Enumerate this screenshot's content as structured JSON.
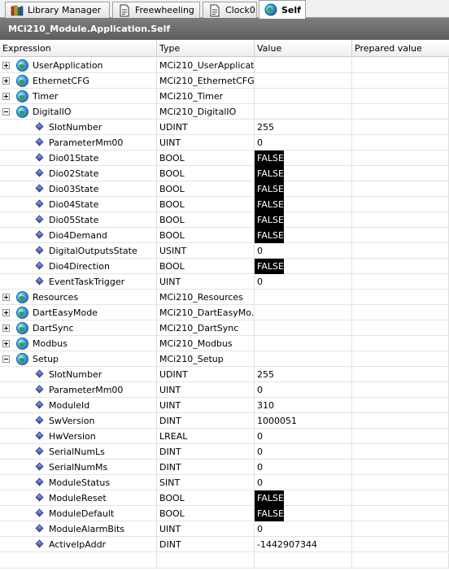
{
  "tabs": [
    {
      "label": "Library Manager",
      "icon": "library-icon",
      "active": false
    },
    {
      "label": "Freewheeling",
      "icon": "document-icon",
      "active": false
    },
    {
      "label": "Clock0",
      "icon": "document-icon",
      "active": false
    },
    {
      "label": "Self",
      "icon": "globe-icon",
      "active": true
    }
  ],
  "title": "MCi210_Module.Application.Self",
  "columns": {
    "expression": "Expression",
    "type": "Type",
    "value": "Value",
    "prepared": "Prepared value"
  },
  "rows": [
    {
      "level": 0,
      "expander": "plus",
      "icon": "globe-icon",
      "name": "UserApplication",
      "type": "MCi210_UserApplicat...",
      "value": "",
      "value_false": false
    },
    {
      "level": 0,
      "expander": "plus",
      "icon": "globe-icon",
      "name": "EthernetCFG",
      "type": "MCi210_EthernetCFG",
      "value": "",
      "value_false": false
    },
    {
      "level": 0,
      "expander": "plus",
      "icon": "globe-icon",
      "name": "Timer",
      "type": "MCi210_Timer",
      "value": "",
      "value_false": false
    },
    {
      "level": 0,
      "expander": "minus",
      "icon": "globe-icon",
      "name": "DigitalIO",
      "type": "MCi210_DigitalIO",
      "value": "",
      "value_false": false
    },
    {
      "level": 1,
      "expander": "",
      "icon": "variable-icon",
      "name": "SlotNumber",
      "type": "UDINT",
      "value": "255",
      "value_false": false
    },
    {
      "level": 1,
      "expander": "",
      "icon": "variable-icon",
      "name": "ParameterMm00",
      "type": "UINT",
      "value": "0",
      "value_false": false
    },
    {
      "level": 1,
      "expander": "",
      "icon": "variable-icon",
      "name": "Dio01State",
      "type": "BOOL",
      "value": "FALSE",
      "value_false": true
    },
    {
      "level": 1,
      "expander": "",
      "icon": "variable-icon",
      "name": "Dio02State",
      "type": "BOOL",
      "value": "FALSE",
      "value_false": true
    },
    {
      "level": 1,
      "expander": "",
      "icon": "variable-icon",
      "name": "Dio03State",
      "type": "BOOL",
      "value": "FALSE",
      "value_false": true
    },
    {
      "level": 1,
      "expander": "",
      "icon": "variable-icon",
      "name": "Dio04State",
      "type": "BOOL",
      "value": "FALSE",
      "value_false": true
    },
    {
      "level": 1,
      "expander": "",
      "icon": "variable-icon",
      "name": "Dio05State",
      "type": "BOOL",
      "value": "FALSE",
      "value_false": true
    },
    {
      "level": 1,
      "expander": "",
      "icon": "variable-icon",
      "name": "Dio4Demand",
      "type": "BOOL",
      "value": "FALSE",
      "value_false": true
    },
    {
      "level": 1,
      "expander": "",
      "icon": "variable-icon",
      "name": "DigitalOutputsState",
      "type": "USINT",
      "value": "0",
      "value_false": false
    },
    {
      "level": 1,
      "expander": "",
      "icon": "variable-icon",
      "name": "Dio4Direction",
      "type": "BOOL",
      "value": "FALSE",
      "value_false": true
    },
    {
      "level": 1,
      "expander": "",
      "icon": "variable-icon",
      "name": "EventTaskTrigger",
      "type": "UINT",
      "value": "0",
      "value_false": false
    },
    {
      "level": 0,
      "expander": "plus",
      "icon": "globe-icon",
      "name": "Resources",
      "type": "MCi210_Resources",
      "value": "",
      "value_false": false
    },
    {
      "level": 0,
      "expander": "plus",
      "icon": "globe-icon",
      "name": "DartEasyMode",
      "type": "MCi210_DartEasyMo...",
      "value": "",
      "value_false": false
    },
    {
      "level": 0,
      "expander": "plus",
      "icon": "globe-icon",
      "name": "DartSync",
      "type": "MCi210_DartSync",
      "value": "",
      "value_false": false
    },
    {
      "level": 0,
      "expander": "plus",
      "icon": "globe-icon",
      "name": "Modbus",
      "type": "MCi210_Modbus",
      "value": "",
      "value_false": false
    },
    {
      "level": 0,
      "expander": "minus",
      "icon": "globe-icon",
      "name": "Setup",
      "type": "MCi210_Setup",
      "value": "",
      "value_false": false
    },
    {
      "level": 1,
      "expander": "",
      "icon": "variable-icon",
      "name": "SlotNumber",
      "type": "UDINT",
      "value": "255",
      "value_false": false
    },
    {
      "level": 1,
      "expander": "",
      "icon": "variable-icon",
      "name": "ParameterMm00",
      "type": "UINT",
      "value": "0",
      "value_false": false
    },
    {
      "level": 1,
      "expander": "",
      "icon": "variable-icon",
      "name": "ModuleId",
      "type": "UINT",
      "value": "310",
      "value_false": false
    },
    {
      "level": 1,
      "expander": "",
      "icon": "variable-icon",
      "name": "SwVersion",
      "type": "DINT",
      "value": "1000051",
      "value_false": false
    },
    {
      "level": 1,
      "expander": "",
      "icon": "variable-icon",
      "name": "HwVersion",
      "type": "LREAL",
      "value": "0",
      "value_false": false
    },
    {
      "level": 1,
      "expander": "",
      "icon": "variable-icon",
      "name": "SerialNumLs",
      "type": "DINT",
      "value": "0",
      "value_false": false
    },
    {
      "level": 1,
      "expander": "",
      "icon": "variable-icon",
      "name": "SerialNumMs",
      "type": "DINT",
      "value": "0",
      "value_false": false
    },
    {
      "level": 1,
      "expander": "",
      "icon": "variable-icon",
      "name": "ModuleStatus",
      "type": "SINT",
      "value": "0",
      "value_false": false
    },
    {
      "level": 1,
      "expander": "",
      "icon": "variable-icon",
      "name": "ModuleReset",
      "type": "BOOL",
      "value": "FALSE",
      "value_false": true
    },
    {
      "level": 1,
      "expander": "",
      "icon": "variable-icon",
      "name": "ModuleDefault",
      "type": "BOOL",
      "value": "FALSE",
      "value_false": true
    },
    {
      "level": 1,
      "expander": "",
      "icon": "variable-icon",
      "name": "ModuleAlarmBits",
      "type": "UINT",
      "value": "0",
      "value_false": false
    },
    {
      "level": 1,
      "expander": "",
      "icon": "variable-icon",
      "name": "ActiveIpAddr",
      "type": "DINT",
      "value": "-1442907344",
      "value_false": false
    }
  ]
}
